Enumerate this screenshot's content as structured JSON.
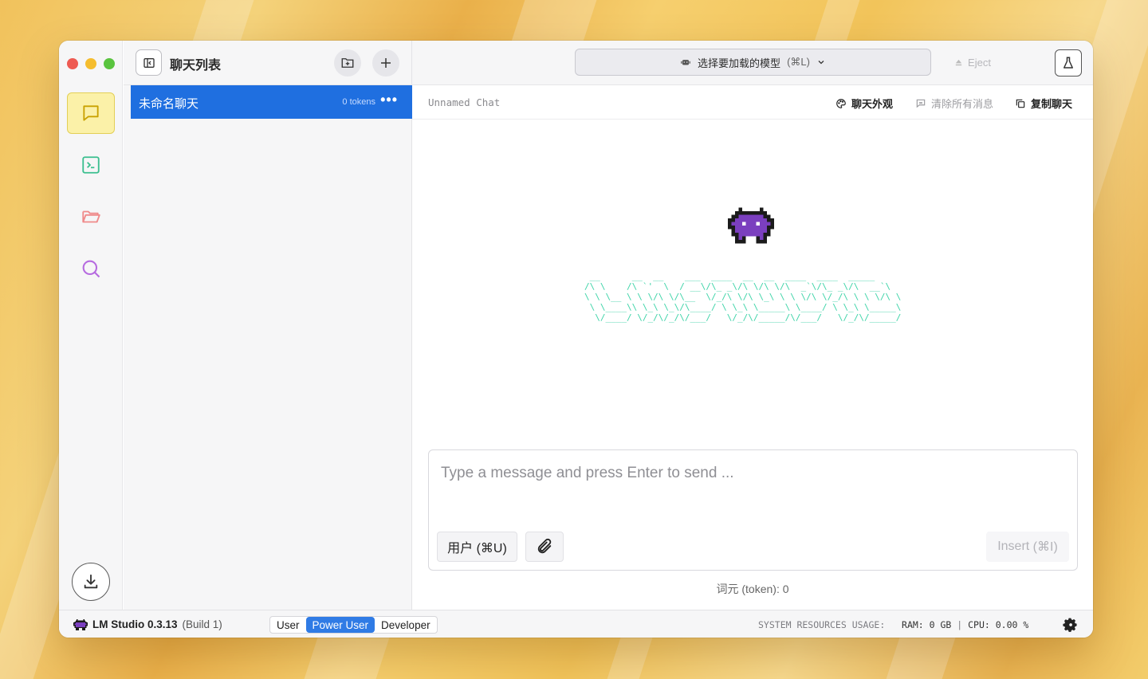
{
  "window": {
    "chat_list_title": "聊天列表",
    "chat_title": "Unnamed Chat"
  },
  "chats": [
    {
      "name": "未命名聊天",
      "tokens": "0 tokens",
      "more": "•••"
    }
  ],
  "topbar": {
    "model_select_label": "选择要加载的模型",
    "model_select_shortcut": "(⌘L)",
    "eject_label": "Eject"
  },
  "chat_header_actions": {
    "appearance": "聊天外观",
    "clear_all": "清除所有消息",
    "duplicate": "复制聊天"
  },
  "ascii_logo": " __      __  __    ___  ____  __  __  ____  ____  _____ \n/\\ \\    /\\ `'  \\  / __\\/\\_ _\\/\\ \\/\\ \\/\\  _`\\/\\_ _\\/\\  __`\\\n\\ \\ \\__ \\ \\ \\/\\ \\/\\__  \\/_/\\ \\/\\ \\_\\ \\ \\ \\/\\ \\/_/\\ \\ \\ \\/\\ \\\n \\ \\____\\\\ \\_\\ \\_\\/\\____/ \\ \\_\\ \\_____\\ \\____/ \\ \\_\\ \\_____\\\n  \\/____/ \\/_/\\/_/\\/___/   \\/_/\\/_____/\\/___/   \\/_/\\/_____/",
  "composer": {
    "placeholder": "Type a message and press Enter to send ...",
    "role_button": "用户 (⌘U)",
    "insert_button": "Insert",
    "insert_shortcut": "(⌘I)"
  },
  "token_count": "词元 (token): 0",
  "footer": {
    "app_name": "LM Studio 0.3.13",
    "build": "(Build 1)",
    "modes": [
      "User",
      "Power User",
      "Developer"
    ],
    "active_mode": "Power User",
    "system_resources_label": "SYSTEM RESOURCES USAGE:",
    "ram": "RAM: 0 GB",
    "cpu": "CPU: 0.00 %"
  },
  "colors": {
    "accent": "#1f6fe0",
    "active_rail": "#fbf1a8",
    "mascot": "#7b3fbf",
    "ascii": "#3ed4a8"
  }
}
